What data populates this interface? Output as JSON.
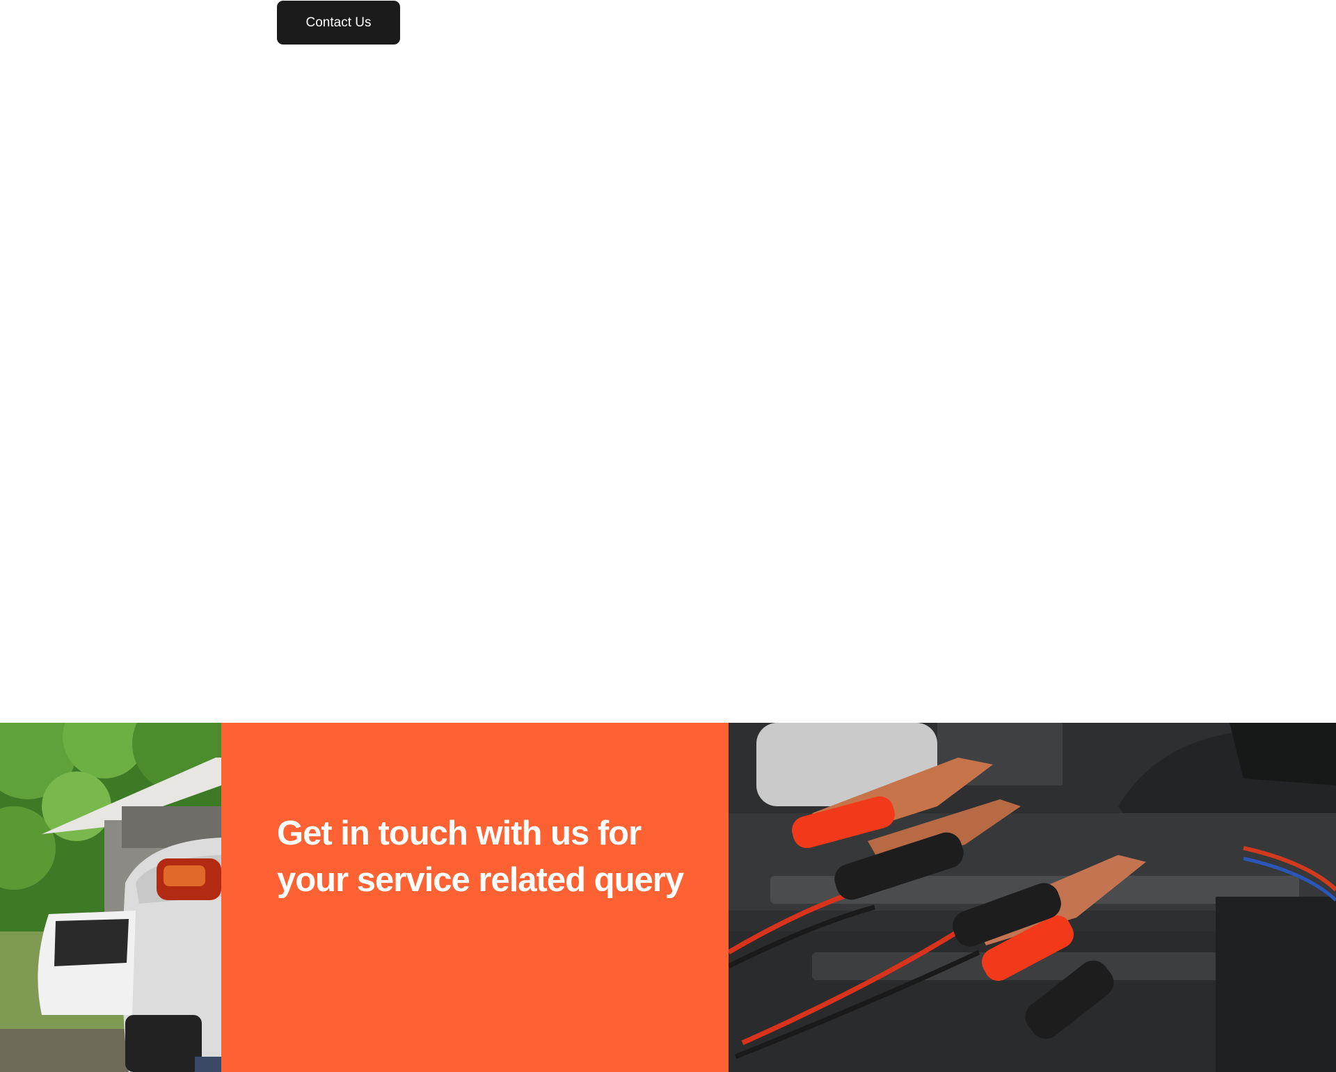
{
  "header": {
    "contact_button_label": "Contact Us"
  },
  "cta": {
    "heading_line1": "Get in touch with us for",
    "heading_line2": "your service related query",
    "accent_color": "#fe6232"
  },
  "images": {
    "left": "car-in-driveway-photo",
    "right": "jumper-cables-engine-photo"
  },
  "colors": {
    "button_bg": "#1b1b1b",
    "button_text": "#ffffff",
    "page_bg": "#ffffff"
  }
}
